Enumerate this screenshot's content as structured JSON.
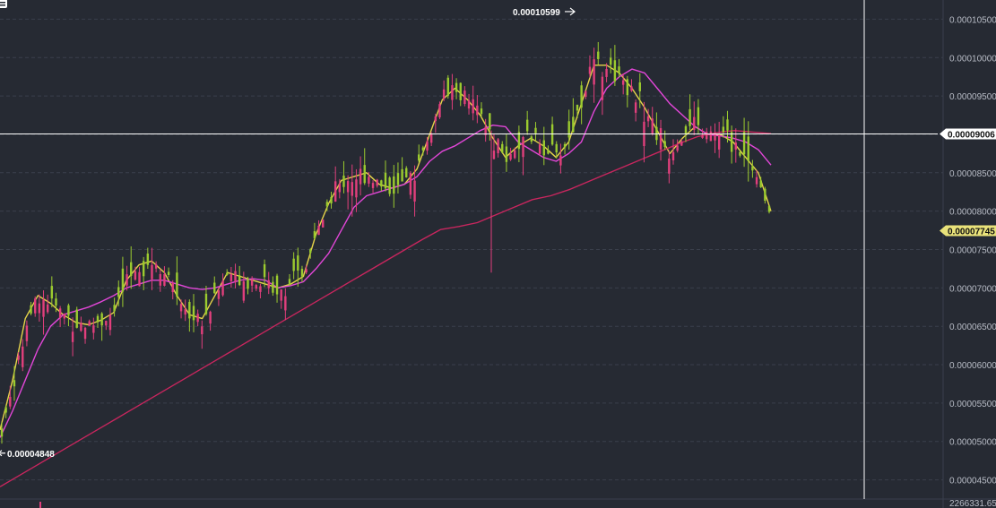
{
  "chart_data": {
    "type": "candlestick",
    "y_axis": {
      "ticks": [
        "0.00010500",
        "0.00010000",
        "0.00009500",
        "0.00009000",
        "0.00008500",
        "0.00008000",
        "0.00007500",
        "0.00007000",
        "0.00006500",
        "0.00006000",
        "0.00005500",
        "0.00005000",
        "0.00004500"
      ],
      "range": [
        4.25e-05,
        0.0001075
      ]
    },
    "grid": true,
    "annotations": {
      "high": {
        "value": 0.00010599,
        "text": "0.00010599"
      },
      "low": {
        "value": 4.848e-05,
        "text": "0.00004848"
      }
    },
    "crosshair": {
      "value": 9.006e-05,
      "text": "0.00009006"
    },
    "last_price": {
      "value": 7.745e-05,
      "text": "0.00007745"
    },
    "volume_label": "2266331.65",
    "series": [
      {
        "name": "",
        "color": "#e6d44a",
        "values": [
          5.15e-05,
          5.8e-05,
          6.6e-05,
          6.9e-05,
          6.8e-05,
          6.65e-05,
          6.55e-05,
          6.52e-05,
          6.58e-05,
          6.68e-05,
          7.1e-05,
          7.3e-05,
          7.35e-05,
          7.2e-05,
          6.9e-05,
          6.65e-05,
          6.6e-05,
          6.9e-05,
          7.2e-05,
          7.15e-05,
          7.1e-05,
          7.05e-05,
          7e-05,
          7.05e-05,
          7.15e-05,
          7.7e-05,
          8.1e-05,
          8.4e-05,
          8.45e-05,
          8.5e-05,
          8.35e-05,
          8.3e-05,
          8.35e-05,
          8.55e-05,
          9e-05,
          9.45e-05,
          9.6e-05,
          9.45e-05,
          9.25e-05,
          8.95e-05,
          8.7e-05,
          8.85e-05,
          8.95e-05,
          8.85e-05,
          8.7e-05,
          8.9e-05,
          9.4e-05,
          9.9e-05,
          9.9e-05,
          9.8e-05,
          9.6e-05,
          9.35e-05,
          9.05e-05,
          8.75e-05,
          8.95e-05,
          9.1e-05,
          9e-05,
          9e-05,
          8.9e-05,
          8.7e-05,
          8.5e-05,
          8e-05
        ]
      },
      {
        "name": "",
        "color": "#e246d8",
        "values": [
          5.05e-05,
          5.4e-05,
          5.8e-05,
          6.2e-05,
          6.5e-05,
          6.65e-05,
          6.7e-05,
          6.75e-05,
          6.82e-05,
          6.9e-05,
          7e-05,
          7.05e-05,
          7.1e-05,
          7.1e-05,
          7.05e-05,
          7e-05,
          6.98e-05,
          7e-05,
          7.05e-05,
          7.1e-05,
          7.12e-05,
          7.1e-05,
          7e-05,
          7.03e-05,
          7.08e-05,
          7.25e-05,
          7.45e-05,
          7.75e-05,
          8.05e-05,
          8.2e-05,
          8.25e-05,
          8.3e-05,
          8.35e-05,
          8.45e-05,
          8.65e-05,
          8.78e-05,
          8.85e-05,
          8.95e-05,
          9.05e-05,
          9.12e-05,
          9.1e-05,
          8.9e-05,
          8.8e-05,
          8.7e-05,
          8.65e-05,
          8.75e-05,
          8.9e-05,
          9.3e-05,
          9.6e-05,
          9.75e-05,
          9.85e-05,
          9.8e-05,
          9.6e-05,
          9.4e-05,
          9.25e-05,
          9.1e-05,
          9e-05,
          8.98e-05,
          8.95e-05,
          8.9e-05,
          8.8e-05,
          8.6e-05
        ]
      },
      {
        "name": "",
        "color": "#c8265e",
        "values": [
          4.41e-05,
          4.55e-05,
          4.69e-05,
          4.83e-05,
          4.97e-05,
          5.11e-05,
          5.25e-05,
          5.39e-05,
          5.53e-05,
          5.67e-05,
          5.81e-05,
          5.95e-05,
          6.09e-05,
          6.23e-05,
          6.37e-05,
          6.51e-05,
          6.65e-05,
          6.79e-05,
          6.93e-05,
          7.07e-05,
          7.21e-05,
          7.35e-05,
          7.49e-05,
          7.63e-05,
          7.76e-05,
          7.8e-05,
          7.85e-05,
          7.95e-05,
          8.05e-05,
          8.15e-05,
          8.2e-05,
          8.28e-05,
          8.38e-05,
          8.48e-05,
          8.58e-05,
          8.68e-05,
          8.78e-05,
          8.88e-05,
          8.97e-05,
          9.02e-05,
          9.05e-05,
          9.03e-05,
          9.01e-05
        ]
      }
    ]
  },
  "icons": {
    "menu": "menu-icon"
  },
  "colors": {
    "up": "#9ccb2f",
    "down": "#e13f7c",
    "grid": "#3a3f4c",
    "bg": "#262a33"
  }
}
